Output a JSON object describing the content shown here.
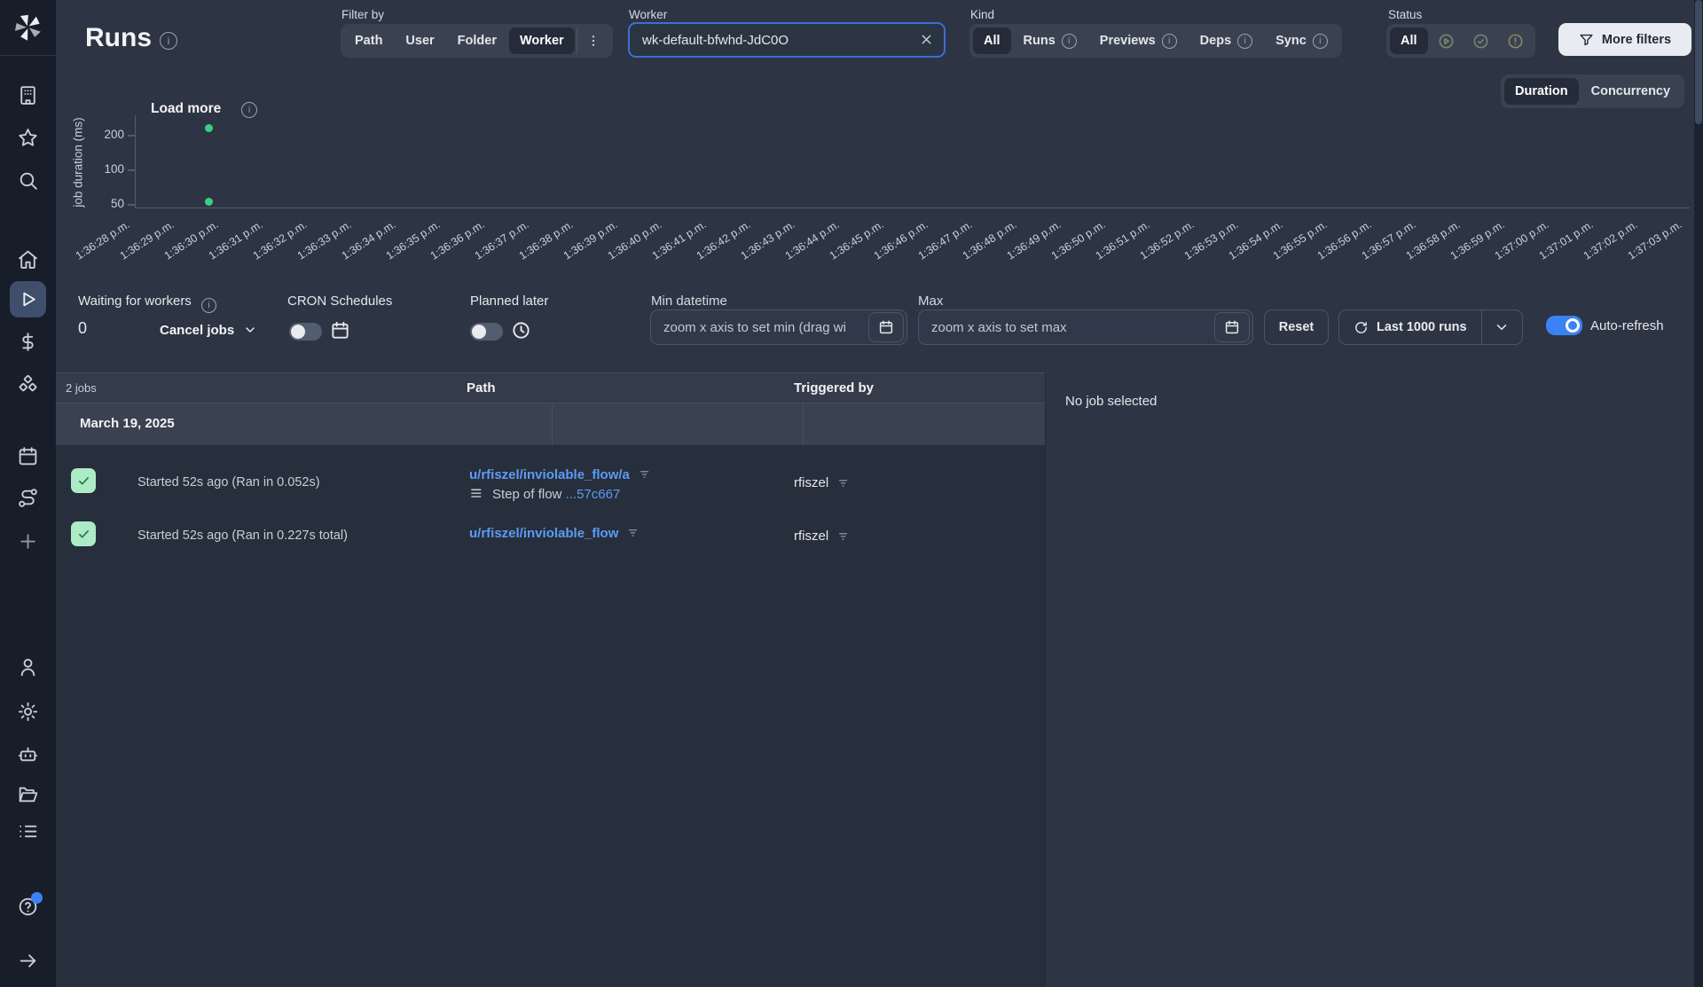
{
  "header": {
    "title": "Runs",
    "filter_by": {
      "label": "Filter by",
      "options": [
        "Path",
        "User",
        "Folder",
        "Worker"
      ],
      "selected": "Worker"
    },
    "worker_field": {
      "label": "Worker",
      "value": "wk-default-bfwhd-JdC0O"
    },
    "kind": {
      "label": "Kind",
      "options": [
        "All",
        "Runs",
        "Previews",
        "Deps",
        "Sync"
      ],
      "selected": "All"
    },
    "status": {
      "label": "Status",
      "all_label": "All",
      "selected": "All",
      "icon_options": [
        "running",
        "success",
        "failure"
      ]
    },
    "more_filters_label": "More filters"
  },
  "view_toggle": {
    "options": [
      "Duration",
      "Concurrency"
    ],
    "selected": "Duration"
  },
  "chart_data": {
    "type": "scatter",
    "load_more_label": "Load more",
    "ylabel": "job duration (ms)",
    "yscale": "log",
    "yticks": [
      50,
      100,
      200
    ],
    "x_labels": [
      "1:36:28 p.m.",
      "1:36:29 p.m.",
      "1:36:30 p.m.",
      "1:36:31 p.m.",
      "1:36:32 p.m.",
      "1:36:33 p.m.",
      "1:36:34 p.m.",
      "1:36:35 p.m.",
      "1:36:36 p.m.",
      "1:36:37 p.m.",
      "1:36:38 p.m.",
      "1:36:39 p.m.",
      "1:36:40 p.m.",
      "1:36:41 p.m.",
      "1:36:42 p.m.",
      "1:36:43 p.m.",
      "1:36:44 p.m.",
      "1:36:45 p.m.",
      "1:36:46 p.m.",
      "1:36:47 p.m.",
      "1:36:48 p.m.",
      "1:36:49 p.m.",
      "1:36:50 p.m.",
      "1:36:51 p.m.",
      "1:36:52 p.m.",
      "1:36:53 p.m.",
      "1:36:54 p.m.",
      "1:36:55 p.m.",
      "1:36:56 p.m.",
      "1:36:57 p.m.",
      "1:36:58 p.m.",
      "1:36:59 p.m.",
      "1:37:00 p.m.",
      "1:37:01 p.m.",
      "1:37:02 p.m.",
      "1:37:03 p.m."
    ],
    "points": [
      {
        "x": "1:36:30 p.m.",
        "y_ms": 227,
        "color": "#3BCE87"
      },
      {
        "x": "1:36:30 p.m.",
        "y_ms": 52,
        "color": "#3BCE87"
      }
    ]
  },
  "controls": {
    "waiting": {
      "label": "Waiting for workers",
      "count": "0",
      "cancel_label": "Cancel jobs"
    },
    "cron": {
      "label": "CRON Schedules",
      "enabled": false
    },
    "planned": {
      "label": "Planned later",
      "enabled": false
    },
    "min_datetime": {
      "label": "Min datetime",
      "placeholder": "zoom x axis to set min (drag wi"
    },
    "max_datetime": {
      "label": "Max",
      "placeholder": "zoom x axis to set max"
    },
    "reset_label": "Reset",
    "last_runs_label": "Last 1000 runs",
    "auto_refresh": {
      "label": "Auto-refresh",
      "enabled": true
    }
  },
  "table": {
    "count_label": "2 jobs",
    "columns": [
      "Path",
      "Triggered by"
    ],
    "group_date": "March 19, 2025",
    "rows": [
      {
        "status": "success",
        "started": "Started 52s ago (Ran in 0.052s)",
        "path": "u/rfiszel/inviolable_flow/a",
        "sub_prefix": "Step of flow",
        "sub_link": "...57c667",
        "triggered_by": "rfiszel"
      },
      {
        "status": "success",
        "started": "Started 52s ago (Ran in 0.227s total)",
        "path": "u/rfiszel/inviolable_flow",
        "triggered_by": "rfiszel"
      }
    ]
  },
  "detail_panel": {
    "empty_label": "No job selected"
  },
  "colors": {
    "accent_blue": "#3B82F6",
    "link_blue": "#5B9CF6",
    "dot_green": "#3BCE87",
    "success_badge_bg": "#ACEBC6",
    "success_badge_check": "#1E7B47"
  },
  "sidebar_icons": [
    "windmill-logo",
    "building",
    "star",
    "search",
    "home",
    "play",
    "dollar",
    "boxes",
    "calendar",
    "route",
    "plus",
    "user",
    "settings",
    "bot",
    "folder-open",
    "list",
    "help",
    "arrow-right"
  ]
}
